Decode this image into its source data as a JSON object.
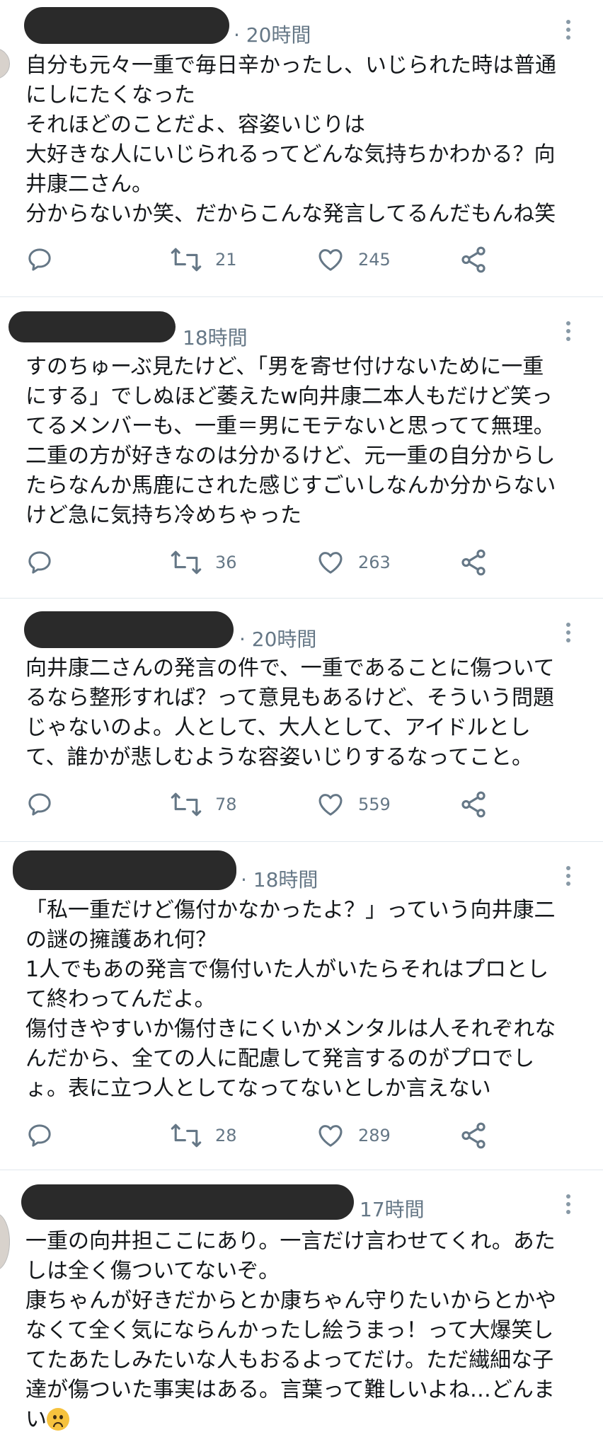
{
  "tweets": [
    {
      "time": "· 20時間",
      "lines": [
        "自分も元々一重で毎日辛かったし、いじられた時は普通",
        "にしにたくなった",
        "それほどのことだよ、容姿いじりは",
        "大好きな人にいじられるってどんな気持ちかわかる？向",
        "井康二さん。",
        "分からないか笑、だからこんな発言してるんだもんね笑"
      ],
      "retweets": "21",
      "likes": "245"
    },
    {
      "time": "18時間",
      "lines": [
        "すのちゅーぶ見たけど、「男を寄せ付けないために一重",
        "にする」でしぬほど萎えたw向井康二本人もだけど笑っ",
        "てるメンバーも、一重＝男にモテないと思ってて無理。",
        "二重の方が好きなのは分かるけど、元一重の自分からし",
        "たらなんか馬鹿にされた感じすごいしなんか分からない",
        "けど急に気持ち冷めちゃった"
      ],
      "retweets": "36",
      "likes": "263"
    },
    {
      "time": "· 20時間",
      "lines": [
        "向井康二さんの発言の件で、一重であることに傷ついて",
        "るなら整形すれば？って意見もあるけど、そういう問題",
        "じゃないのよ。人として、大人として、アイドルとし",
        "て、誰かが悲しむような容姿いじりするなってこと。"
      ],
      "retweets": "78",
      "likes": "559"
    },
    {
      "time": "· 18時間",
      "lines": [
        "「私一重だけど傷付かなかったよ？」っていう向井康二",
        "の謎の擁護あれ何？",
        "1人でもあの発言で傷付いた人がいたらそれはプロとし",
        "て終わってんだよ。",
        "傷付きやすいか傷付きにくいかメンタルは人それぞれな",
        "んだから、全ての人に配慮して発言するのがプロでし",
        "ょ。表に立つ人としてなってないとしか言えない"
      ],
      "retweets": "28",
      "likes": "289"
    },
    {
      "time": "17時間",
      "lines": [
        "一重の向井担ここにあり。一言だけ言わせてくれ。あた",
        "しは全く傷ついてないぞ。",
        "康ちゃんが好きだからとか康ちゃん守りたいからとかや",
        "なくて全く気にならんかったし絵うまっ！って大爆笑し",
        "てたあたしみたいな人もおるよってだけ。ただ繊細な子",
        "達が傷ついた事実はある。言葉って難しいよね…どんま",
        "い"
      ],
      "last_line_emoji": "sad-face-emoji"
    }
  ],
  "icons": {
    "reply": "reply-icon",
    "retweet": "retweet-icon",
    "like": "heart-icon",
    "share": "share-icon",
    "more": "more-vertical-icon"
  },
  "colors": {
    "text": "#14171a",
    "secondary": "#657786",
    "divider": "#e1e8ed",
    "redaction": "#2a2a2a"
  }
}
